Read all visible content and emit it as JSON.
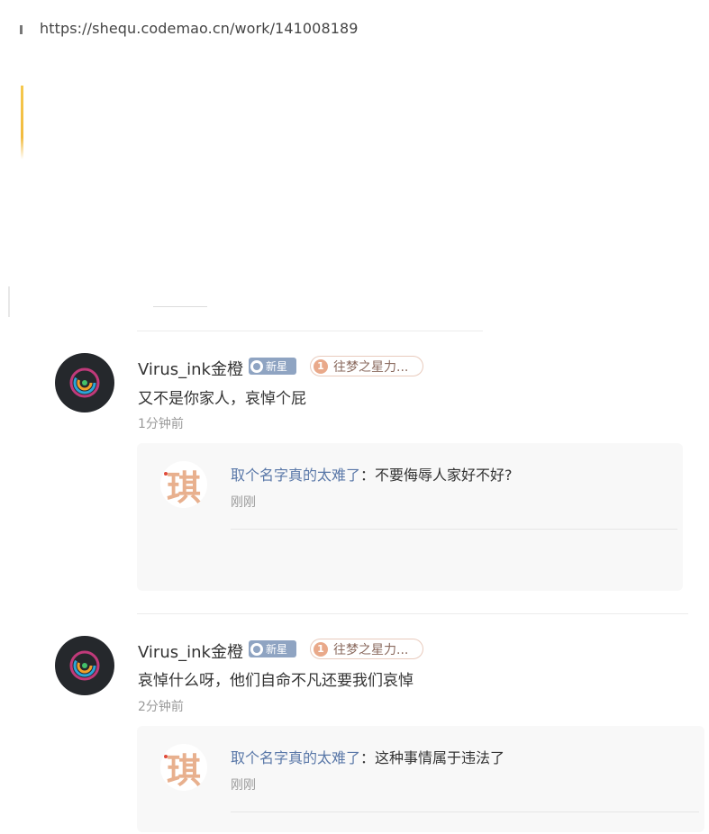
{
  "browser": {
    "url": "https://shequ.codemao.cn/work/141008189"
  },
  "comments": [
    {
      "author": "Virus_ink金橙",
      "badge_new": "新星",
      "badge_rank_num": "1",
      "badge_rank_label": "往梦之星力...",
      "content": "又不是你家人，哀悼个屁",
      "time": "1分钟前",
      "reply": {
        "avatar_char": "琪",
        "author": "取个名字真的太难了",
        "separator": "：",
        "text": "不要侮辱人家好不好?",
        "time": "刚刚"
      }
    },
    {
      "author": "Virus_ink金橙",
      "badge_new": "新星",
      "badge_rank_num": "1",
      "badge_rank_label": "往梦之星力...",
      "content": "哀悼什么呀，他们自命不凡还要我们哀悼",
      "time": "2分钟前",
      "reply": {
        "avatar_char": "琪",
        "author": "取个名字真的太难了",
        "separator": "：",
        "text": "这种事情属于违法了",
        "time": "刚刚"
      }
    }
  ]
}
